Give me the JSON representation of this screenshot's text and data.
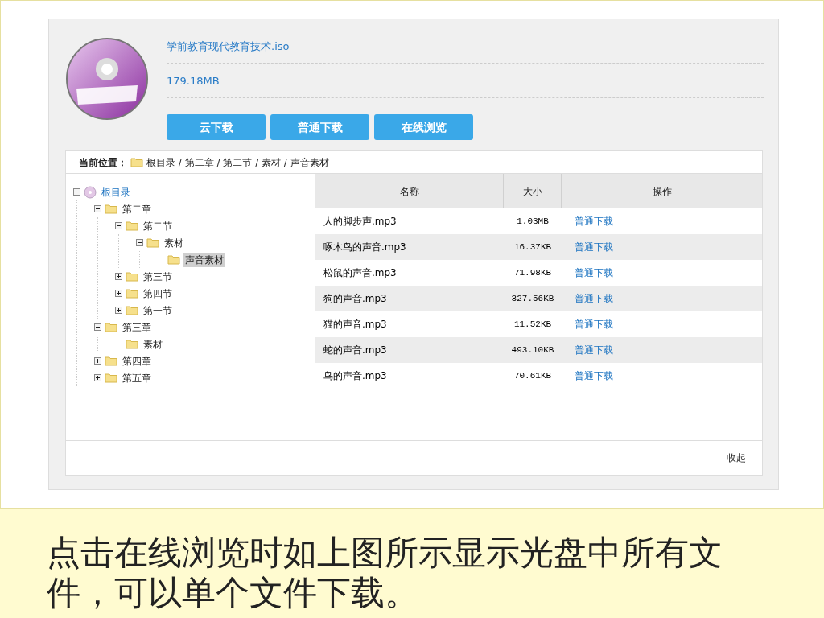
{
  "file": {
    "name": "学前教育现代教育技术.iso",
    "size": "179.18MB"
  },
  "buttons": [
    "云下载",
    "普通下载",
    "在线浏览"
  ],
  "location": {
    "label": "当前位置：",
    "path": "根目录 / 第二章 / 第二节 / 素材 / 声音素材"
  },
  "tree": {
    "label": "根目录",
    "kind": "expanded",
    "selected": false,
    "children": [
      {
        "label": "第二章",
        "kind": "expanded",
        "selected": false,
        "children": [
          {
            "label": "第二节",
            "kind": "expanded",
            "selected": false,
            "children": [
              {
                "label": "素材",
                "kind": "expanded",
                "selected": false,
                "children": [
                  {
                    "label": "声音素材",
                    "kind": "leaf",
                    "selected": true
                  }
                ]
              }
            ]
          },
          {
            "label": "第三节",
            "kind": "collapsed",
            "selected": false
          },
          {
            "label": "第四节",
            "kind": "collapsed",
            "selected": false
          },
          {
            "label": "第一节",
            "kind": "collapsed",
            "selected": false
          }
        ]
      },
      {
        "label": "第三章",
        "kind": "expanded",
        "selected": false,
        "children": [
          {
            "label": "素材",
            "kind": "leaf",
            "selected": false
          }
        ]
      },
      {
        "label": "第四章",
        "kind": "collapsed",
        "selected": false
      },
      {
        "label": "第五章",
        "kind": "collapsed",
        "selected": false
      }
    ]
  },
  "table": {
    "columns": [
      "名称",
      "大小",
      "操作"
    ],
    "rows": [
      {
        "name": "人的脚步声.mp3",
        "size": "1.03MB",
        "action": "普通下载"
      },
      {
        "name": "啄木鸟的声音.mp3",
        "size": "16.37KB",
        "action": "普通下载"
      },
      {
        "name": "松鼠的声音.mp3",
        "size": "71.98KB",
        "action": "普通下载"
      },
      {
        "name": "狗的声音.mp3",
        "size": "327.56KB",
        "action": "普通下载"
      },
      {
        "name": "猫的声音.mp3",
        "size": "11.52KB",
        "action": "普通下载"
      },
      {
        "name": "蛇的声音.mp3",
        "size": "493.10KB",
        "action": "普通下载"
      },
      {
        "name": "鸟的声音.mp3",
        "size": "70.61KB",
        "action": "普通下载"
      }
    ]
  },
  "collapse": "收起",
  "caption": "点击在线浏览时如上图所示显示光盘中所有文件，可以单个文件下载。"
}
